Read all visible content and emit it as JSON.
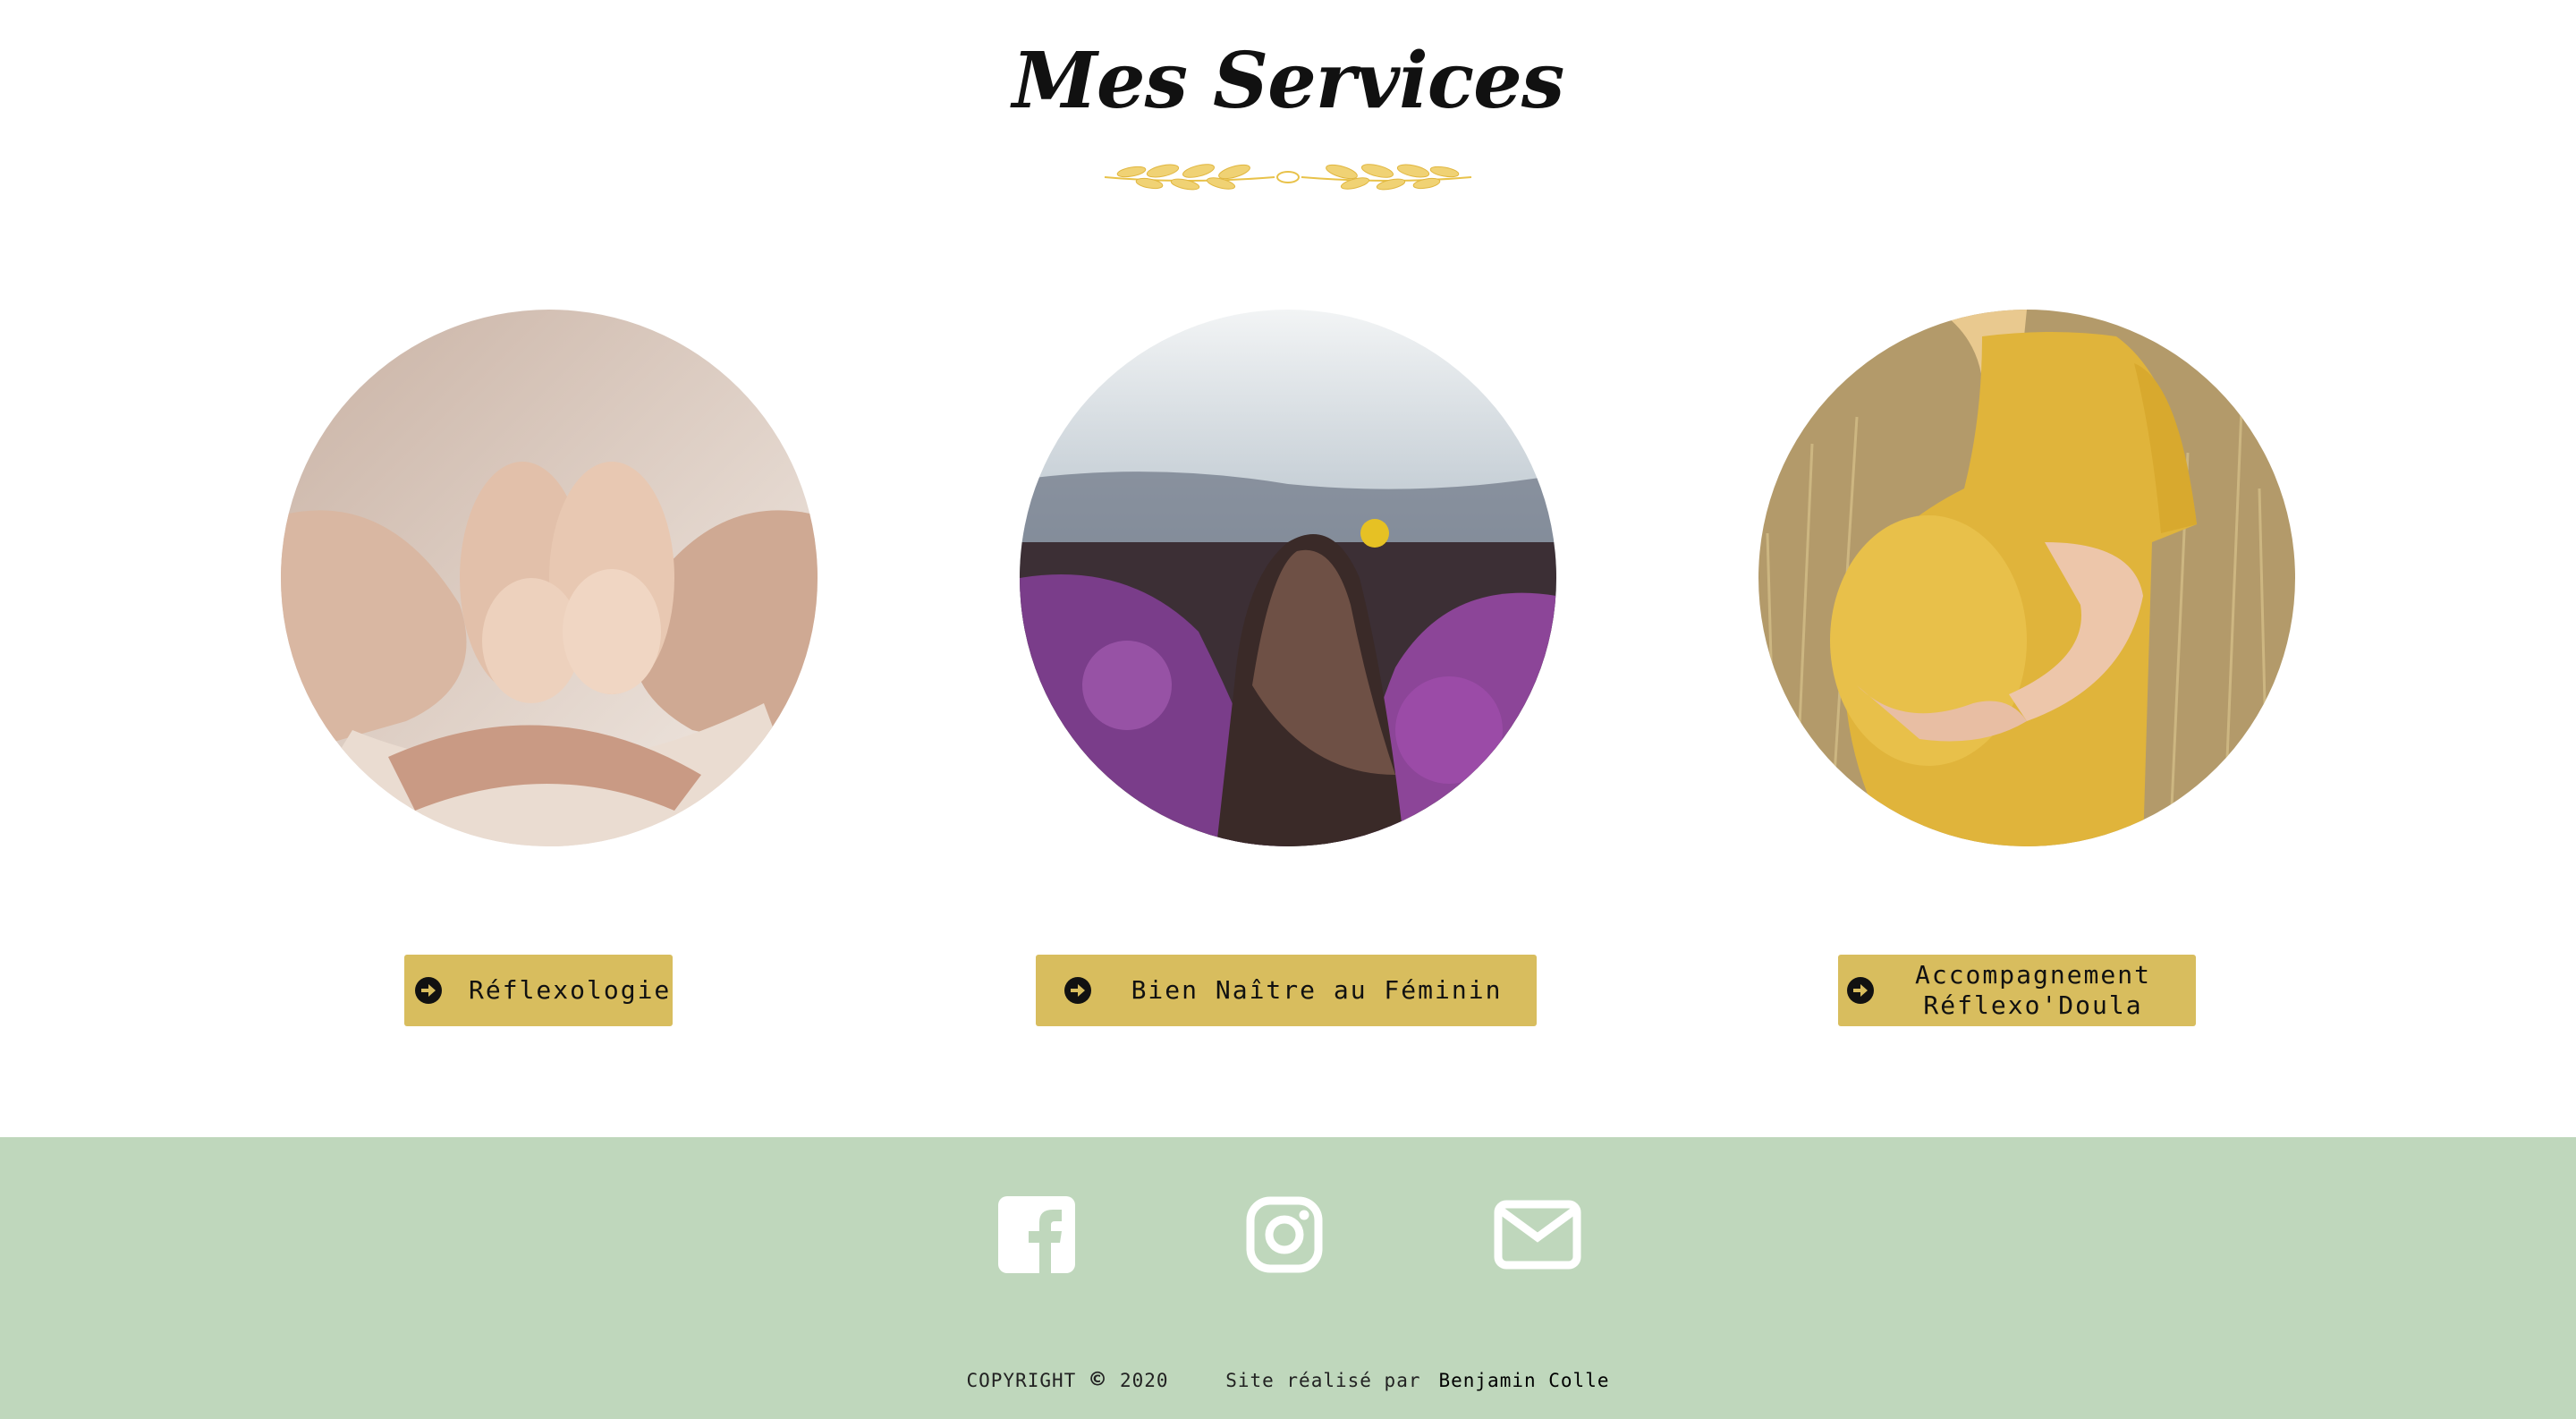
{
  "section": {
    "title": "Mes Services"
  },
  "services": [
    {
      "label": "Réflexologie",
      "image": "baby-feet-in-hands-photo"
    },
    {
      "label": "Bien Naître au Féminin",
      "image": "woman-in-lavender-field-photo"
    },
    {
      "label_line1": "Accompagnement",
      "label_line2": "Réflexo'Doula",
      "image": "pregnant-woman-yellow-dress-photo"
    }
  ],
  "icons": {
    "arrow": "arrow-circle-right-icon",
    "facebook": "facebook-icon",
    "instagram": "instagram-icon",
    "email": "envelope-icon"
  },
  "footer": {
    "copyright_label": "COPYRIGHT",
    "copyright_symbol": "©",
    "year": "2020",
    "credit_prefix": "Site réalisé par",
    "credit_name": "Benjamin Colle"
  },
  "colors": {
    "button": "#d8bd5e",
    "footer_bg": "#bfd7bc",
    "laurel": "#e8c24a"
  }
}
